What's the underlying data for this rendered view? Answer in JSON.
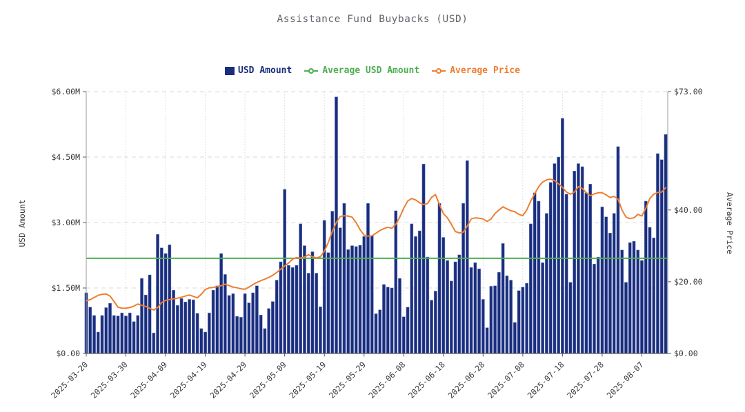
{
  "title": "Assistance Fund Buybacks (USD)",
  "chart_data": {
    "type": "bar",
    "title": "Assistance Fund Buybacks (USD)",
    "x_tick_labels": [
      "2025-03-20",
      "2025-03-30",
      "2025-04-09",
      "2025-04-19",
      "2025-04-29",
      "2025-05-09",
      "2025-05-19",
      "2025-05-29",
      "2025-06-08",
      "2025-06-18",
      "2025-06-28",
      "2025-07-08",
      "2025-07-18",
      "2025-07-28",
      "2025-08-07"
    ],
    "x_tick_every": 10,
    "left_axis": {
      "label": "USD Amount",
      "ticks": [
        "$0.00",
        "$1.50M",
        "$3.00M",
        "$4.50M",
        "$6.00M"
      ],
      "tick_values": [
        0,
        1.5,
        3,
        4.5,
        6
      ],
      "max": 6
    },
    "right_axis": {
      "label": "Average Price",
      "ticks": [
        "$0.00",
        "$20.00",
        "$40.00",
        "$73.00"
      ],
      "tick_values": [
        0,
        20,
        40,
        73
      ],
      "max": 73
    },
    "series": [
      {
        "name": "USD Amount",
        "type": "bar",
        "axis": "left",
        "color": "#1b2e7d",
        "unit": "millions USD",
        "values": [
          1.39,
          1.06,
          0.87,
          0.49,
          0.87,
          1.05,
          1.15,
          0.87,
          0.86,
          0.93,
          0.86,
          0.93,
          0.73,
          0.87,
          1.72,
          1.34,
          1.8,
          0.47,
          2.73,
          2.42,
          2.29,
          2.49,
          1.45,
          1.1,
          1.26,
          1.18,
          1.24,
          1.23,
          0.92,
          0.57,
          0.49,
          0.93,
          1.45,
          1.55,
          2.29,
          1.81,
          1.33,
          1.37,
          0.85,
          0.83,
          1.37,
          1.16,
          1.39,
          1.55,
          0.88,
          0.57,
          1.03,
          1.19,
          1.68,
          2.1,
          3.76,
          2.02,
          1.97,
          2.02,
          2.97,
          2.47,
          1.84,
          2.33,
          1.84,
          1.07,
          3.05,
          2.31,
          3.26,
          5.88,
          2.88,
          3.44,
          2.38,
          2.47,
          2.45,
          2.48,
          2.68,
          3.44,
          2.7,
          0.91,
          1.0,
          1.58,
          1.52,
          1.5,
          3.27,
          1.72,
          0.84,
          1.06,
          2.97,
          2.68,
          2.81,
          4.34,
          2.21,
          1.22,
          1.43,
          3.44,
          2.66,
          2.13,
          1.66,
          2.1,
          2.26,
          3.44,
          4.42,
          1.97,
          2.08,
          1.94,
          1.24,
          0.59,
          1.54,
          1.55,
          1.86,
          2.52,
          1.78,
          1.68,
          0.71,
          1.44,
          1.52,
          1.61,
          2.97,
          3.68,
          3.49,
          2.08,
          3.21,
          3.92,
          4.35,
          4.5,
          5.39,
          3.65,
          1.63,
          4.18,
          4.35,
          4.28,
          3.68,
          3.88,
          2.05,
          2.21,
          3.36,
          3.13,
          2.76,
          3.21,
          4.74,
          2.37,
          1.63,
          2.54,
          2.57,
          2.37,
          2.13,
          3.49,
          2.89,
          2.65,
          4.58,
          4.44,
          5.02
        ]
      },
      {
        "name": "Average USD Amount",
        "type": "line",
        "axis": "left",
        "color": "#4caf50",
        "unit": "millions USD",
        "constant_value": 2.18
      },
      {
        "name": "Average Price",
        "type": "line",
        "axis": "right",
        "color": "#ee7e30",
        "unit": "USD",
        "values": [
          14.7,
          15.0,
          15.6,
          16.2,
          16.5,
          16.6,
          16.0,
          14.5,
          12.9,
          12.6,
          12.6,
          12.8,
          13.2,
          13.8,
          13.4,
          13.1,
          12.6,
          12.1,
          12.8,
          14.2,
          14.8,
          15.0,
          15.2,
          15.4,
          15.7,
          16.0,
          16.3,
          15.9,
          15.5,
          16.5,
          17.8,
          18.3,
          18.4,
          18.6,
          18.9,
          19.3,
          18.9,
          18.5,
          18.3,
          18.0,
          17.9,
          18.5,
          19.2,
          19.8,
          20.3,
          20.7,
          21.2,
          21.8,
          22.6,
          23.5,
          24.4,
          25.2,
          26.3,
          26.7,
          26.6,
          26.9,
          27.5,
          27.0,
          26.6,
          27.0,
          28.5,
          31.0,
          34.0,
          36.5,
          38.2,
          38.4,
          38.3,
          38.0,
          36.5,
          34.5,
          33.0,
          32.7,
          32.8,
          33.5,
          34.3,
          34.8,
          35.2,
          34.9,
          36.0,
          38.0,
          40.5,
          42.5,
          43.2,
          42.8,
          42.0,
          41.5,
          41.8,
          43.5,
          44.3,
          41.5,
          39.0,
          37.8,
          36.0,
          34.0,
          33.6,
          33.8,
          35.5,
          37.5,
          37.8,
          37.7,
          37.5,
          36.8,
          37.5,
          39.0,
          40.0,
          40.9,
          40.3,
          39.8,
          39.5,
          38.8,
          38.4,
          40.0,
          42.5,
          44.5,
          46.5,
          47.8,
          48.4,
          48.6,
          48.2,
          47.3,
          46.3,
          45.0,
          44.4,
          45.0,
          46.5,
          46.0,
          44.8,
          44.0,
          44.5,
          44.8,
          44.8,
          44.2,
          43.5,
          43.8,
          43.0,
          40.0,
          38.0,
          37.6,
          37.8,
          38.8,
          38.3,
          40.5,
          43.2,
          44.4,
          44.9,
          45.0,
          46.2
        ]
      }
    ]
  }
}
